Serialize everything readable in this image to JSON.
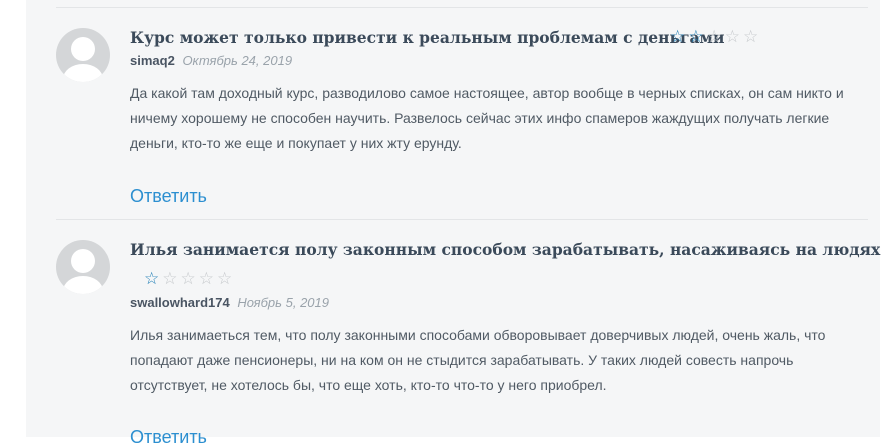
{
  "comments": [
    {
      "title": "Курс может только привести к реальным проблемам с деньгами",
      "rating": 2,
      "rating_max": 5,
      "author": "simaq2",
      "date": "Октябрь 24, 2019",
      "text": "Да какой там доходный курс, разводилово самое настоящее, автор вообще в черных списках, он сам никто и ничему хорошему не способен научить. Развелось сейчас этих инфо спамеров жаждущих получать легкие деньги, кто-то же еще и покупает у них жту ерунду.",
      "reply_label": "Ответить"
    },
    {
      "title": "Илья занимается полу законным способом зарабатывать, насаживаясь на людях",
      "rating": 1,
      "rating_max": 5,
      "author": "swallowhard174",
      "date": "Ноябрь 5, 2019",
      "text": "Илья занимаеться тем, что полу законными способами обворовывает доверчивых людей, очень жаль, что попадают даже пенсионеры, ни на ком он не стыдится зарабатывать. У таких людей совесть напрочь отсутствует, не хотелось бы, что еще хоть, кто-то что-то у него приобрел.",
      "reply_label": "Ответить"
    }
  ],
  "colors": {
    "star_filled": "#2380b7",
    "star_empty": "#c6c9cc",
    "reply_link": "#2c8fd0"
  },
  "icons": {
    "avatar": "default-user-avatar",
    "star": "star-icon"
  }
}
